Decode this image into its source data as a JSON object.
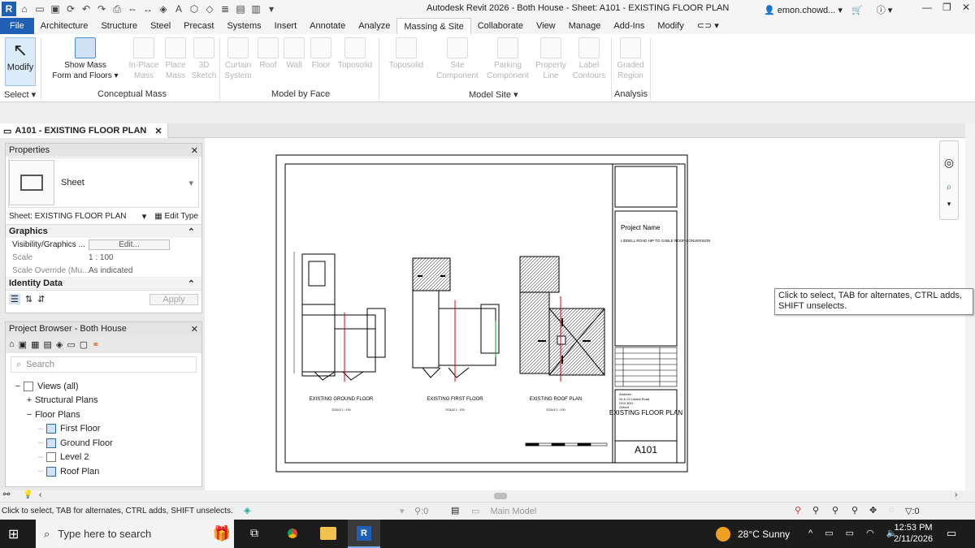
{
  "app": {
    "title": "Autodesk Revit 2026 - Both House - Sheet: A101 - EXISTING FLOOR PLAN",
    "user": "emon.chowd...",
    "logo": "R"
  },
  "ribbon_tabs": [
    "File",
    "Architecture",
    "Structure",
    "Steel",
    "Precast",
    "Systems",
    "Insert",
    "Annotate",
    "Analyze",
    "Massing & Site",
    "Collaborate",
    "View",
    "Manage",
    "Add-Ins",
    "Modify"
  ],
  "ribbon": {
    "modify": "Modify",
    "select": "Select",
    "show_mass_1": "Show Mass",
    "show_mass_2": "Form and Floors",
    "conceptual": [
      {
        "l1": "In-Place",
        "l2": "Mass"
      },
      {
        "l1": "Place",
        "l2": "Mass"
      },
      {
        "l1": "3D",
        "l2": "Sketch"
      }
    ],
    "conceptual_label": "Conceptual Mass",
    "by_face": [
      {
        "l1": "Curtain",
        "l2": "System"
      },
      {
        "l1": "Roof",
        "l2": ""
      },
      {
        "l1": "Wall",
        "l2": ""
      },
      {
        "l1": "Floor",
        "l2": ""
      },
      {
        "l1": "Toposolid",
        "l2": ""
      }
    ],
    "by_face_label": "Model by Face",
    "site": [
      {
        "l1": "Toposolid",
        "l2": ""
      },
      {
        "l1": "Site",
        "l2": "Component"
      },
      {
        "l1": "Parking",
        "l2": "Component"
      },
      {
        "l1": "Property",
        "l2": "Line"
      },
      {
        "l1": "Label",
        "l2": "Contours"
      }
    ],
    "site_label": "Model Site",
    "analysis": [
      {
        "l1": "Graded",
        "l2": "Region"
      }
    ],
    "analysis_label": "Analysis"
  },
  "view_tab": "A101 - EXISTING FLOOR PLAN",
  "properties": {
    "title": "Properties",
    "type": "Sheet",
    "selector": "Sheet: EXISTING FLOOR PLAN",
    "edit_type": "Edit Type",
    "graphics": "Graphics",
    "rows": [
      {
        "k": "Visibility/Graphics ...",
        "v": "Edit..."
      },
      {
        "k": "Scale",
        "v": "1 : 100"
      },
      {
        "k": "Scale Override (Mu...",
        "v": "As indicated"
      }
    ],
    "identity": "Identity Data",
    "apply": "Apply"
  },
  "browser": {
    "title": "Project Browser - Both House",
    "search": "Search",
    "tree": [
      {
        "label": "Views (all)",
        "indent": 0,
        "sign": "−"
      },
      {
        "label": "Structural Plans",
        "indent": 1,
        "sign": "+"
      },
      {
        "label": "Floor Plans",
        "indent": 1,
        "sign": "−"
      },
      {
        "label": "First Floor",
        "indent": 2,
        "sign": ""
      },
      {
        "label": "Ground Floor",
        "indent": 2,
        "sign": ""
      },
      {
        "label": "Level 2",
        "indent": 2,
        "sign": ""
      },
      {
        "label": "Roof Plan",
        "indent": 2,
        "sign": ""
      }
    ]
  },
  "sheet": {
    "labels": [
      "EXISTING GROUND FLOOR",
      "EXISTING FIRST FLOOR",
      "EXISTING ROOF PLAN"
    ],
    "scale": "SCALE 1 : 100",
    "project_name": "Project Name",
    "project_desc": "LIDDELL ROAD HIP TO GABLE ROOF CONVERSION",
    "address": [
      "Address:",
      "26 & 22 Liddell Road",
      "OX4 3DU",
      "Oxford"
    ],
    "sheet_title": "EXISTING FLOOR PLAN",
    "sheet_no": "A101"
  },
  "tooltip": "Click to select, TAB for alternates, CTRL adds, SHIFT unselects.",
  "status": {
    "text": "Click to select, TAB for alternates, CTRL adds, SHIFT unselects.",
    "count": ":0",
    "model": "Main Model",
    "filter": ":0"
  },
  "taskbar": {
    "search": "Type here to search",
    "weather": "28°C  Sunny",
    "time": "12:53 PM",
    "date": "2/11/2026"
  }
}
